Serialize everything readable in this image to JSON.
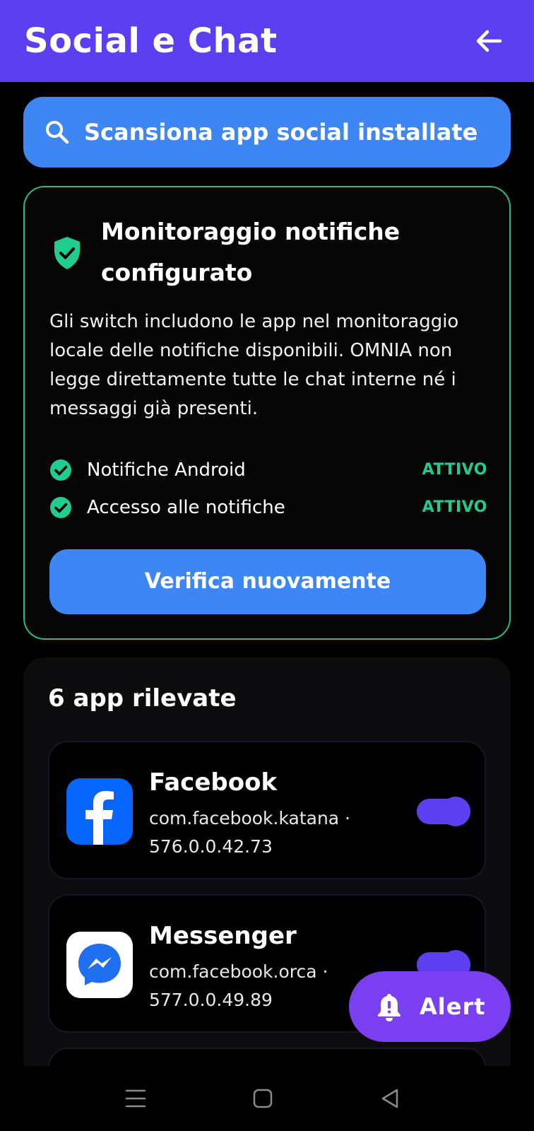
{
  "appbar": {
    "title": "Social e Chat"
  },
  "scan": {
    "label": "Scansiona app social installate"
  },
  "status": {
    "title": "Monitoraggio notifiche configurato",
    "description": "Gli switch includono le app nel monitoraggio locale delle notifiche disponibili. OMNIA non legge direttamente tutte le chat interne né i messaggi già presenti.",
    "permissions": [
      {
        "label": "Notifiche Android",
        "state": "ATTIVO"
      },
      {
        "label": "Accesso alle notifiche",
        "state": "ATTIVO"
      }
    ],
    "verify_label": "Verifica nuovamente"
  },
  "apps": {
    "title": "6 app rilevate",
    "items": [
      {
        "name": "Facebook",
        "meta": "com.facebook.katana · 576.0.0.42.73",
        "enabled": true,
        "icon": "facebook-icon"
      },
      {
        "name": "Messenger",
        "meta": "com.facebook.orca · 577.0.0.49.89",
        "enabled": true,
        "icon": "messenger-icon"
      }
    ]
  },
  "fab": {
    "label": "Alert",
    "icon": "bell-icon"
  },
  "colors": {
    "primary": "#5b3ff0",
    "accent_blue": "#3e86f4",
    "success": "#1fce8e",
    "fab": "#7a3ff0"
  }
}
